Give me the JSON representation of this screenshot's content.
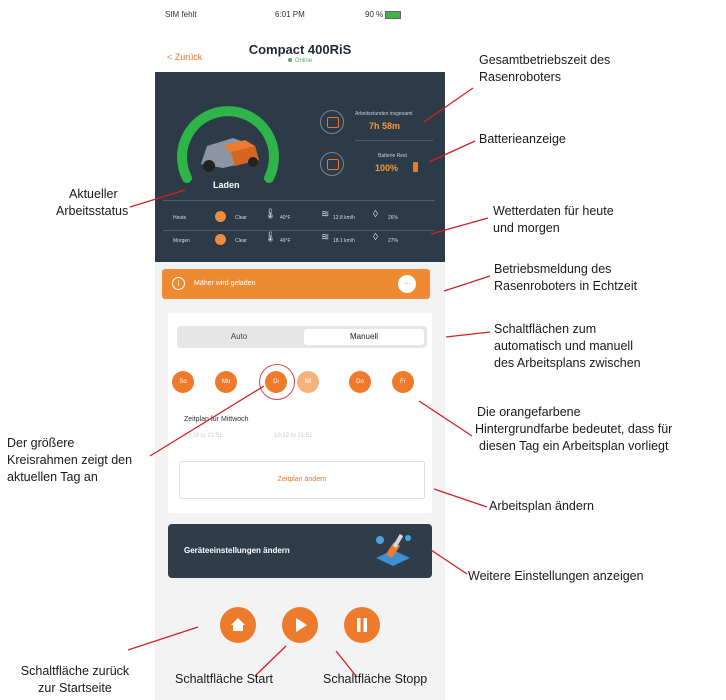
{
  "status_bar": {
    "carrier": "SIM fehlt",
    "time": "6:01 PM",
    "battery": "90 %"
  },
  "nav": {
    "back": "< Zurück",
    "title": "Compact 400RiS",
    "connection": "Online"
  },
  "dashboard": {
    "state": "Laden",
    "worktime_title": "Arbeitsstunden insgesamt",
    "worktime_value": "7h 58m",
    "battery_title": "Batterie Rest",
    "battery_value": "100%",
    "weather": [
      {
        "day": "Heute",
        "cond": "Clear",
        "temp": "40°F",
        "wind": "12.8 km/h",
        "hum": "26%"
      },
      {
        "day": "Morgen",
        "cond": "Clear",
        "temp": "49°F",
        "wind": "18.1 km/h",
        "hum": "27%"
      }
    ]
  },
  "banner": {
    "text": "Mäher wird geladen",
    "more": "..."
  },
  "schedule": {
    "modes": [
      "Auto",
      "Manuell"
    ],
    "active_mode": "Manuell",
    "days": [
      "So",
      "Mo",
      "Di",
      "Mi",
      "Do",
      "Fr"
    ],
    "current_day": "Di",
    "title": "Zeitplan für Mittwoch",
    "times": [
      "10:19 to 21:51",
      "10:19 to 21:51"
    ],
    "change": "Zeitplan ändern"
  },
  "settings": {
    "label": "Geräteeinstellungen ändern"
  },
  "annotations": {
    "gesamt": [
      "Gesamtbetriebszeit des",
      "Rasenroboters"
    ],
    "batterie": [
      "Batterieanzeige"
    ],
    "status": [
      "Aktueller",
      "Arbeitsstatus"
    ],
    "wetter": [
      "Wetterdaten für heute",
      "und morgen"
    ],
    "meldung": [
      "Betriebsmeldung des",
      "Rasenroboters in Echtzeit"
    ],
    "modus": [
      "Schaltflächen zum",
      "automatisch und manuell",
      "des Arbeitsplans zwischen"
    ],
    "orange": [
      "Die orangefarbene",
      "Hintergrundfarbe bedeutet, dass für",
      "diesen Tag ein Arbeitsplan vorliegt"
    ],
    "kreis": [
      "Der größere",
      "Kreisrahmen zeigt den",
      "aktuellen Tag an"
    ],
    "plan": [
      "Arbeitsplan ändern"
    ],
    "weitere": [
      "Weitere Einstellungen anzeigen"
    ],
    "home": [
      "Schaltfläche zurück",
      "zur Startseite"
    ],
    "start": [
      "Schaltfläche Start"
    ],
    "stopp": [
      "Schaltfläche Stopp"
    ]
  },
  "colors": {
    "accent": "#ee7b2c",
    "dashboard": "#2d3a48",
    "gauge": "#2fb44a",
    "annotation_line": "#d42020"
  }
}
